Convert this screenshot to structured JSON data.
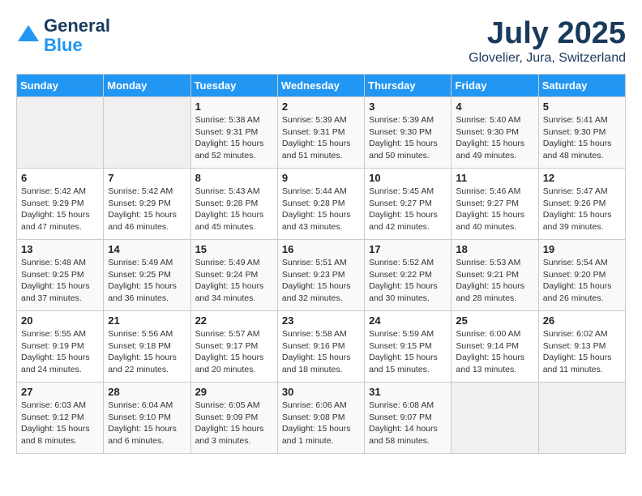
{
  "header": {
    "logo_line1": "General",
    "logo_line2": "Blue",
    "month": "July 2025",
    "location": "Glovelier, Jura, Switzerland"
  },
  "weekdays": [
    "Sunday",
    "Monday",
    "Tuesday",
    "Wednesday",
    "Thursday",
    "Friday",
    "Saturday"
  ],
  "weeks": [
    [
      {
        "day": "",
        "info": ""
      },
      {
        "day": "",
        "info": ""
      },
      {
        "day": "1",
        "info": "Sunrise: 5:38 AM\nSunset: 9:31 PM\nDaylight: 15 hours\nand 52 minutes."
      },
      {
        "day": "2",
        "info": "Sunrise: 5:39 AM\nSunset: 9:31 PM\nDaylight: 15 hours\nand 51 minutes."
      },
      {
        "day": "3",
        "info": "Sunrise: 5:39 AM\nSunset: 9:30 PM\nDaylight: 15 hours\nand 50 minutes."
      },
      {
        "day": "4",
        "info": "Sunrise: 5:40 AM\nSunset: 9:30 PM\nDaylight: 15 hours\nand 49 minutes."
      },
      {
        "day": "5",
        "info": "Sunrise: 5:41 AM\nSunset: 9:30 PM\nDaylight: 15 hours\nand 48 minutes."
      }
    ],
    [
      {
        "day": "6",
        "info": "Sunrise: 5:42 AM\nSunset: 9:29 PM\nDaylight: 15 hours\nand 47 minutes."
      },
      {
        "day": "7",
        "info": "Sunrise: 5:42 AM\nSunset: 9:29 PM\nDaylight: 15 hours\nand 46 minutes."
      },
      {
        "day": "8",
        "info": "Sunrise: 5:43 AM\nSunset: 9:28 PM\nDaylight: 15 hours\nand 45 minutes."
      },
      {
        "day": "9",
        "info": "Sunrise: 5:44 AM\nSunset: 9:28 PM\nDaylight: 15 hours\nand 43 minutes."
      },
      {
        "day": "10",
        "info": "Sunrise: 5:45 AM\nSunset: 9:27 PM\nDaylight: 15 hours\nand 42 minutes."
      },
      {
        "day": "11",
        "info": "Sunrise: 5:46 AM\nSunset: 9:27 PM\nDaylight: 15 hours\nand 40 minutes."
      },
      {
        "day": "12",
        "info": "Sunrise: 5:47 AM\nSunset: 9:26 PM\nDaylight: 15 hours\nand 39 minutes."
      }
    ],
    [
      {
        "day": "13",
        "info": "Sunrise: 5:48 AM\nSunset: 9:25 PM\nDaylight: 15 hours\nand 37 minutes."
      },
      {
        "day": "14",
        "info": "Sunrise: 5:49 AM\nSunset: 9:25 PM\nDaylight: 15 hours\nand 36 minutes."
      },
      {
        "day": "15",
        "info": "Sunrise: 5:49 AM\nSunset: 9:24 PM\nDaylight: 15 hours\nand 34 minutes."
      },
      {
        "day": "16",
        "info": "Sunrise: 5:51 AM\nSunset: 9:23 PM\nDaylight: 15 hours\nand 32 minutes."
      },
      {
        "day": "17",
        "info": "Sunrise: 5:52 AM\nSunset: 9:22 PM\nDaylight: 15 hours\nand 30 minutes."
      },
      {
        "day": "18",
        "info": "Sunrise: 5:53 AM\nSunset: 9:21 PM\nDaylight: 15 hours\nand 28 minutes."
      },
      {
        "day": "19",
        "info": "Sunrise: 5:54 AM\nSunset: 9:20 PM\nDaylight: 15 hours\nand 26 minutes."
      }
    ],
    [
      {
        "day": "20",
        "info": "Sunrise: 5:55 AM\nSunset: 9:19 PM\nDaylight: 15 hours\nand 24 minutes."
      },
      {
        "day": "21",
        "info": "Sunrise: 5:56 AM\nSunset: 9:18 PM\nDaylight: 15 hours\nand 22 minutes."
      },
      {
        "day": "22",
        "info": "Sunrise: 5:57 AM\nSunset: 9:17 PM\nDaylight: 15 hours\nand 20 minutes."
      },
      {
        "day": "23",
        "info": "Sunrise: 5:58 AM\nSunset: 9:16 PM\nDaylight: 15 hours\nand 18 minutes."
      },
      {
        "day": "24",
        "info": "Sunrise: 5:59 AM\nSunset: 9:15 PM\nDaylight: 15 hours\nand 15 minutes."
      },
      {
        "day": "25",
        "info": "Sunrise: 6:00 AM\nSunset: 9:14 PM\nDaylight: 15 hours\nand 13 minutes."
      },
      {
        "day": "26",
        "info": "Sunrise: 6:02 AM\nSunset: 9:13 PM\nDaylight: 15 hours\nand 11 minutes."
      }
    ],
    [
      {
        "day": "27",
        "info": "Sunrise: 6:03 AM\nSunset: 9:12 PM\nDaylight: 15 hours\nand 8 minutes."
      },
      {
        "day": "28",
        "info": "Sunrise: 6:04 AM\nSunset: 9:10 PM\nDaylight: 15 hours\nand 6 minutes."
      },
      {
        "day": "29",
        "info": "Sunrise: 6:05 AM\nSunset: 9:09 PM\nDaylight: 15 hours\nand 3 minutes."
      },
      {
        "day": "30",
        "info": "Sunrise: 6:06 AM\nSunset: 9:08 PM\nDaylight: 15 hours\nand 1 minute."
      },
      {
        "day": "31",
        "info": "Sunrise: 6:08 AM\nSunset: 9:07 PM\nDaylight: 14 hours\nand 58 minutes."
      },
      {
        "day": "",
        "info": ""
      },
      {
        "day": "",
        "info": ""
      }
    ]
  ]
}
